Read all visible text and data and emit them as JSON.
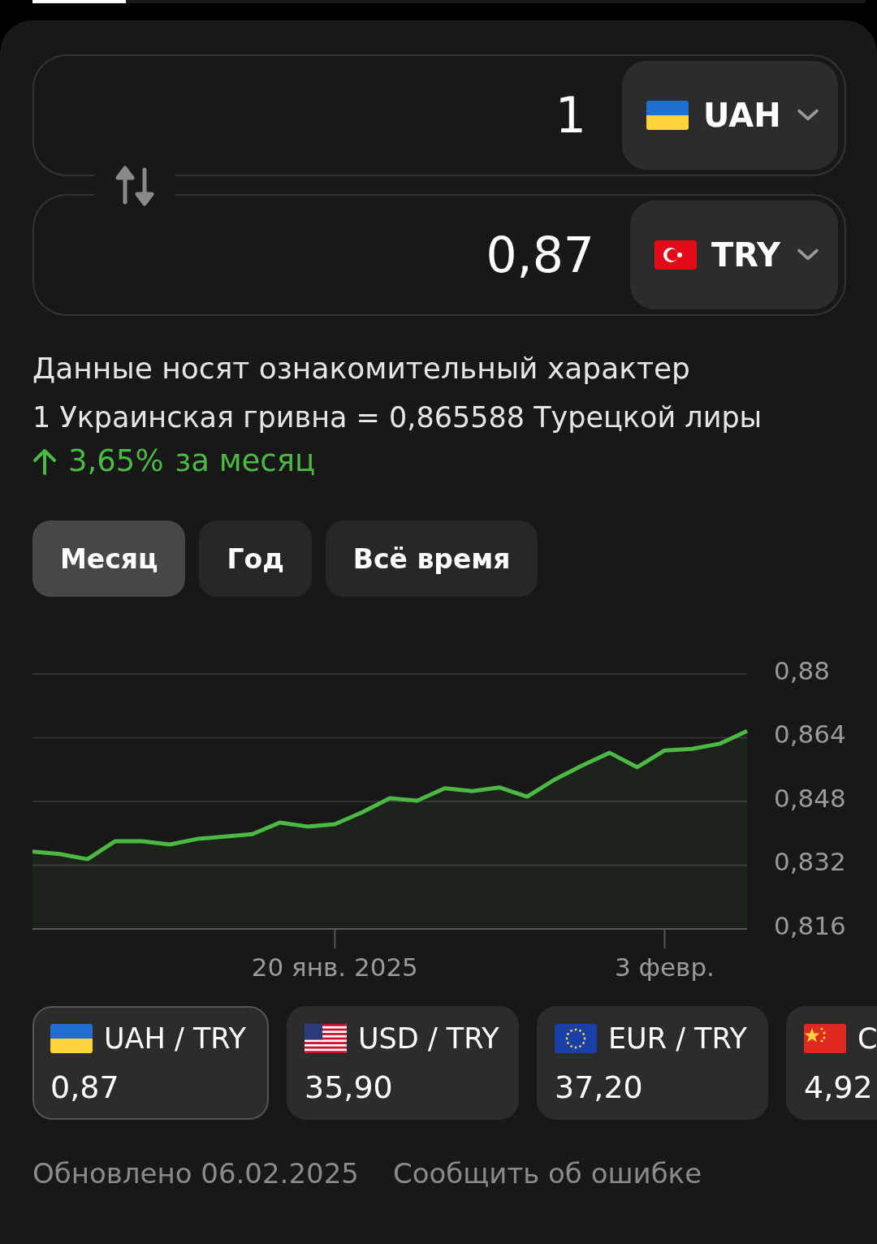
{
  "converter": {
    "rows": [
      {
        "amount": "1",
        "currency": "UAH",
        "kind": "ua"
      },
      {
        "amount": "0,87",
        "currency": "TRY",
        "kind": "tr"
      }
    ]
  },
  "disclaimer": "Данные носят ознакомительный характер",
  "rate": "1 Украинская гривна = 0,865588 Турецкой лиры",
  "change": {
    "value": "3,65%",
    "period": "за месяц"
  },
  "periods": [
    {
      "label": "Месяц",
      "selected": true
    },
    {
      "label": "Год",
      "selected": false
    },
    {
      "label": "Всё время",
      "selected": false
    }
  ],
  "chart_data": {
    "type": "area",
    "categories": [
      null,
      null,
      null,
      null,
      null,
      null,
      null,
      null,
      null,
      null,
      null,
      "20 янв. 2025",
      null,
      null,
      null,
      null,
      null,
      null,
      null,
      null,
      null,
      null,
      null,
      "3 февр.",
      null,
      null,
      null
    ],
    "series": [
      {
        "color": "#4cb944",
        "values": [
          0.8354,
          0.8348,
          0.8335,
          0.838,
          0.838,
          0.8372,
          0.8386,
          0.8392,
          0.8398,
          0.8427,
          0.8417,
          0.8423,
          0.8453,
          0.8488,
          0.8482,
          0.8513,
          0.8506,
          0.8515,
          0.8492,
          0.8535,
          0.857,
          0.8602,
          0.8566,
          0.8608,
          0.8612,
          0.8625,
          0.8657
        ]
      }
    ],
    "ylim": [
      0.816,
      0.88
    ],
    "grid": true,
    "yticks": [
      {
        "value": 0.88,
        "label": "0,88"
      },
      {
        "value": 0.864,
        "label": "0,864"
      },
      {
        "value": 0.848,
        "label": "0,848"
      },
      {
        "value": 0.832,
        "label": "0,832"
      },
      {
        "value": 0.816,
        "label": "0,816"
      }
    ]
  },
  "pairs": [
    {
      "label": "UAH / TRY",
      "value": "0,87",
      "kind": "ua",
      "selected": true
    },
    {
      "label": "USD / TRY",
      "value": "35,90",
      "kind": "us",
      "selected": false
    },
    {
      "label": "EUR / TRY",
      "value": "37,20",
      "kind": "eu",
      "selected": false
    },
    {
      "label": "C",
      "value": "4,92",
      "kind": "cn",
      "selected": false
    }
  ],
  "footer": {
    "updated": "Обновлено 06.02.2025",
    "report": "Сообщить об ошибке"
  }
}
